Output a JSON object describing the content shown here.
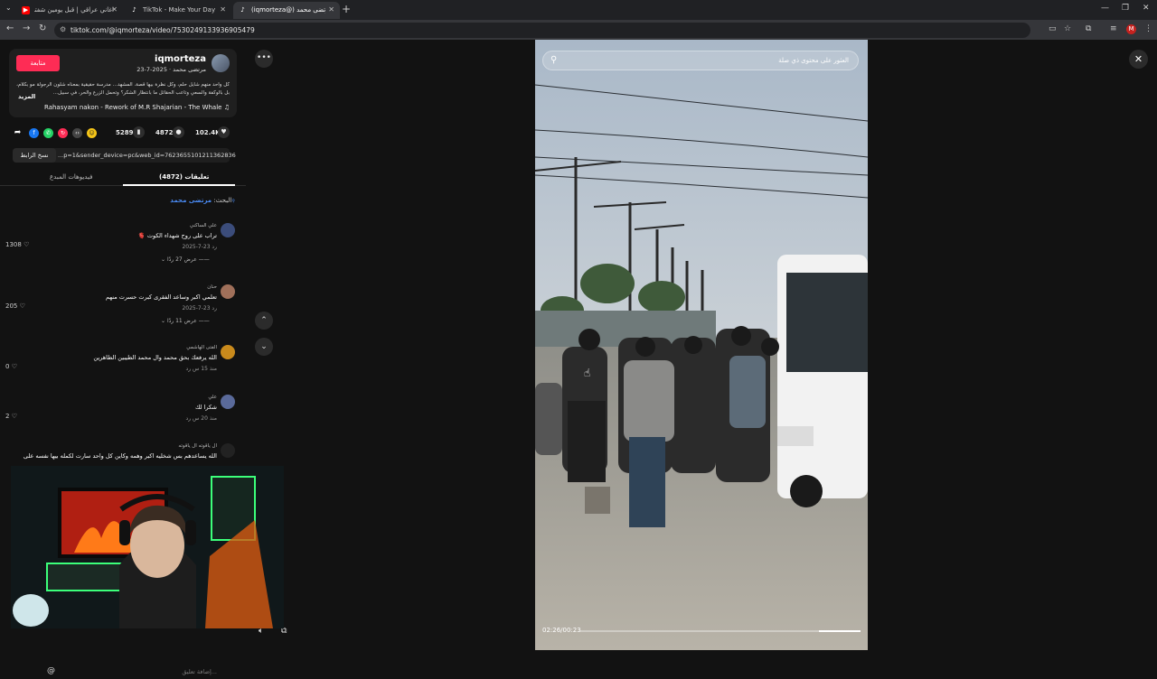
{
  "browser": {
    "tabs": [
      {
        "title": "اغاني عراقي | قبل يومين شفته و...",
        "favicon": "youtube-icon",
        "active": false
      },
      {
        "title": "TikTok - Make Your Day",
        "favicon": "tiktok-icon",
        "active": false
      },
      {
        "title": "(iqmorteza@) مرتضى محمد",
        "favicon": "tiktok-icon",
        "active": true
      }
    ],
    "new_tab": "+",
    "url": "tiktok.com/@iqmorteza/video/7530249133936905479",
    "profile_initial": "M"
  },
  "author": {
    "username": "iqmorteza",
    "subline": "مرتضى محمد · 2025-7-23",
    "follow_label": "متابعة",
    "caption": "كل واحد منهم شايل حلم، وكل نظرة بيها قصة. المشهد… مدرسة حقيقية بمعناه شلون الرجولة مو بكلام، بل بالوكفة والسعي وتاعب الحقائل ما بانتظار الشكر؟ وتحمل الزرع والحر، في سبيل...",
    "more_label": "المزيد",
    "music": "Rahasyam nakon - Rework of M.R Shajarian - The Whale"
  },
  "stats": {
    "likes": "102.4K",
    "comments": "4872",
    "saves": "5289"
  },
  "link": {
    "copy_label": "نسخ الرابط",
    "text": "...p=1&sender_device=pc&web_id=7623655101211362836"
  },
  "panel_tabs": {
    "comments": "تعليقات (4872)",
    "creator_videos": "فيديوهات المبدع"
  },
  "search_line": {
    "prefix": "البحث:",
    "query": "مرتضى محمد"
  },
  "comments": [
    {
      "user": "علي الساكني",
      "text": "تراب على روح شهداء الكوت 🫀",
      "meta": "2025-7-23   رد",
      "likes": "1308",
      "replies": "عرض 27 ردًا"
    },
    {
      "user": "حنان",
      "text": "تعلمي اكبر وساعد الفقرى كبرت حسرت منهم",
      "meta": "2025-7-23   رد",
      "likes": "205",
      "replies": "عرض 11 ردًا"
    },
    {
      "user": "الفتى الهاشمي",
      "text": "الله يرفعك بحق محمد وال محمد الطيبين الطاهرين",
      "meta": "منذ 15 س   رد",
      "likes": "0",
      "replies": ""
    },
    {
      "user": "علي",
      "text": "شكرا لك",
      "meta": "منذ 20 س   رد",
      "likes": "2",
      "replies": ""
    },
    {
      "user": "ال ياقوته ال ياقوته",
      "text": "الله يساعدهم بس شخليه اكبر وهمه وكاين كل واحد سارت لكمله بيها نفسه على",
      "meta": "",
      "likes": "",
      "replies": ""
    }
  ],
  "comment_input_placeholder": "إضافة تعليق...",
  "video": {
    "search_placeholder": "العثور على محتوى ذي صلة",
    "time": "02:26/00:23",
    "progress": 0.15
  }
}
